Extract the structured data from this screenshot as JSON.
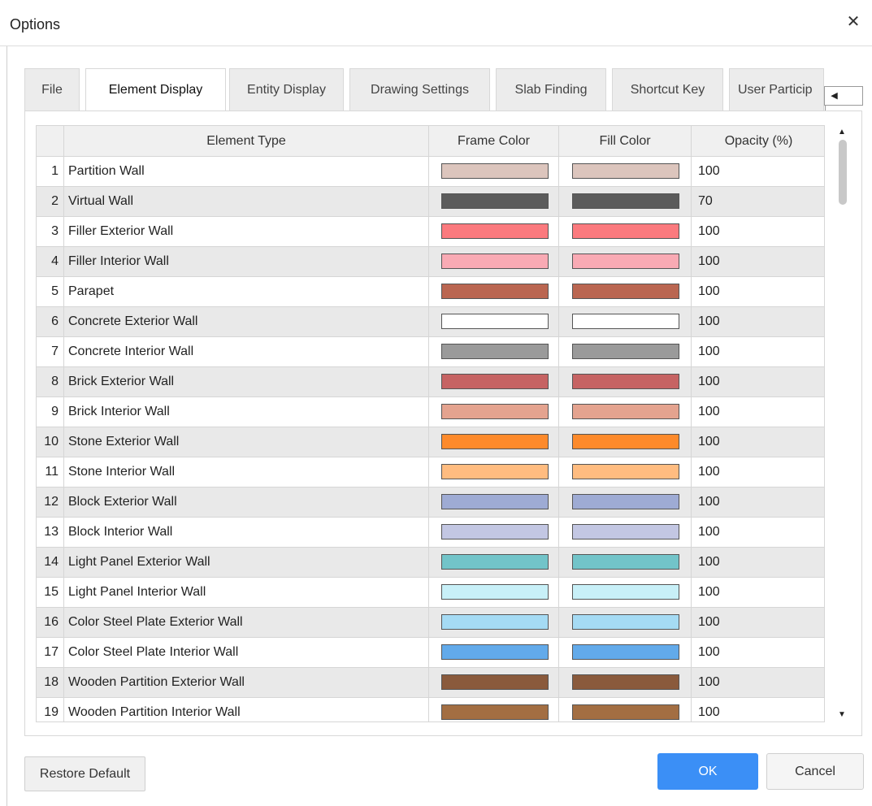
{
  "window": {
    "title": "Options",
    "close_glyph": "✕"
  },
  "tabs": [
    {
      "label": "File",
      "active": false
    },
    {
      "label": "Element Display",
      "active": true
    },
    {
      "label": "Entity Display",
      "active": false
    },
    {
      "label": "Drawing Settings",
      "active": false
    },
    {
      "label": "Slab Finding",
      "active": false
    },
    {
      "label": "Shortcut Key",
      "active": false
    },
    {
      "label": "User Particip",
      "active": false
    }
  ],
  "tab_scroll": {
    "left_glyph": "◀",
    "right_glyph": "▶"
  },
  "table": {
    "headers": {
      "element_type": "Element Type",
      "frame_color": "Frame Color",
      "fill_color": "Fill Color",
      "opacity": "Opacity (%)"
    },
    "rows": [
      {
        "num": "1",
        "type": "Partition Wall",
        "frame": "#dcc5bd",
        "fill": "#dcc5bd",
        "opacity": "100"
      },
      {
        "num": "2",
        "type": "Virtual Wall",
        "frame": "#5b5b5b",
        "fill": "#5b5b5b",
        "opacity": "70"
      },
      {
        "num": "3",
        "type": "Filler Exterior Wall",
        "frame": "#fb7a7e",
        "fill": "#fb7a7e",
        "opacity": "100"
      },
      {
        "num": "4",
        "type": "Filler Interior Wall",
        "frame": "#f9aab4",
        "fill": "#f9aab4",
        "opacity": "100"
      },
      {
        "num": "5",
        "type": "Parapet",
        "frame": "#ba6651",
        "fill": "#ba6651",
        "opacity": "100"
      },
      {
        "num": "6",
        "type": "Concrete Exterior Wall",
        "frame": "#ffffff",
        "fill": "#ffffff",
        "opacity": "100"
      },
      {
        "num": "7",
        "type": "Concrete Interior Wall",
        "frame": "#9a9a9a",
        "fill": "#9a9a9a",
        "opacity": "100"
      },
      {
        "num": "8",
        "type": "Brick Exterior Wall",
        "frame": "#c66363",
        "fill": "#c66363",
        "opacity": "100"
      },
      {
        "num": "9",
        "type": "Brick Interior Wall",
        "frame": "#e4a38f",
        "fill": "#e4a38f",
        "opacity": "100"
      },
      {
        "num": "10",
        "type": "Stone Exterior Wall",
        "frame": "#fd8a2b",
        "fill": "#fd8a2b",
        "opacity": "100"
      },
      {
        "num": "11",
        "type": "Stone Interior Wall",
        "frame": "#ffbc80",
        "fill": "#ffbc80",
        "opacity": "100"
      },
      {
        "num": "12",
        "type": "Block Exterior Wall",
        "frame": "#9eabd4",
        "fill": "#9eabd4",
        "opacity": "100"
      },
      {
        "num": "13",
        "type": "Block Interior Wall",
        "frame": "#c3c7e3",
        "fill": "#c3c7e3",
        "opacity": "100"
      },
      {
        "num": "14",
        "type": "Light Panel Exterior Wall",
        "frame": "#72c4c9",
        "fill": "#72c4c9",
        "opacity": "100"
      },
      {
        "num": "15",
        "type": "Light Panel Interior Wall",
        "frame": "#c8f0f8",
        "fill": "#c8f0f8",
        "opacity": "100"
      },
      {
        "num": "16",
        "type": "Color Steel Plate Exterior Wall",
        "frame": "#a5dbf4",
        "fill": "#a5dbf4",
        "opacity": "100"
      },
      {
        "num": "17",
        "type": "Color Steel Plate Interior Wall",
        "frame": "#62aaea",
        "fill": "#62aaea",
        "opacity": "100"
      },
      {
        "num": "18",
        "type": "Wooden Partition Exterior Wall",
        "frame": "#8a5a3c",
        "fill": "#8a5a3c",
        "opacity": "100"
      },
      {
        "num": "19",
        "type": "Wooden Partition Interior Wall",
        "frame": "#a36e42",
        "fill": "#a36e42",
        "opacity": "100"
      }
    ]
  },
  "scrollbar": {
    "up_glyph": "▲",
    "down_glyph": "▼"
  },
  "buttons": {
    "restore": "Restore Default",
    "ok": "OK",
    "cancel": "Cancel"
  }
}
